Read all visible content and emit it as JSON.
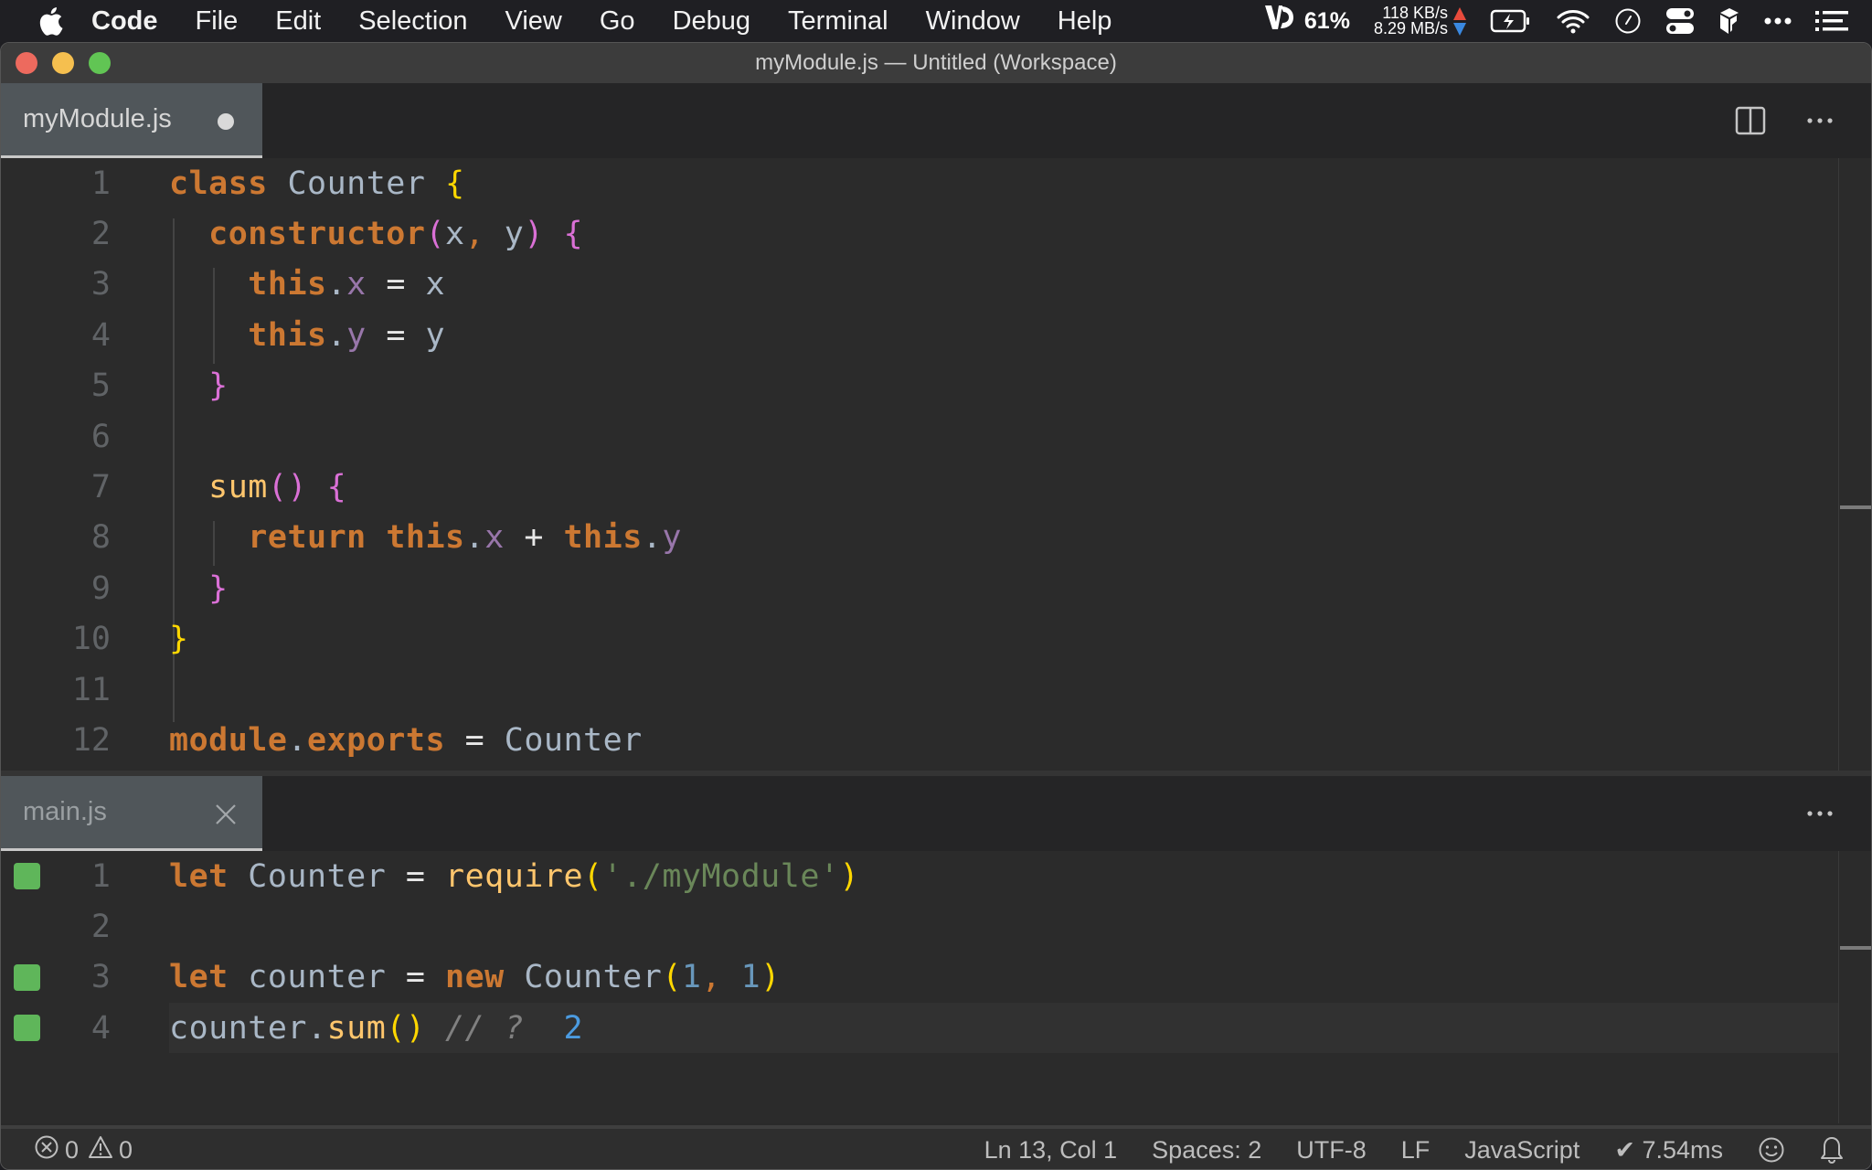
{
  "menubar": {
    "app_name": "Code",
    "items": [
      "File",
      "Edit",
      "Selection",
      "View",
      "Go",
      "Debug",
      "Terminal",
      "Window",
      "Help"
    ],
    "tray": {
      "battery_app_percent": "61%",
      "upload_speed": "118 KB/s",
      "download_speed": "8.29 MB/s",
      "icons": [
        "battery-charging-icon",
        "wifi-icon",
        "clock-icon",
        "control-center-icon",
        "app-tray-icon",
        "more-icon",
        "list-icon"
      ]
    }
  },
  "window": {
    "title": "myModule.js — Untitled (Workspace)"
  },
  "top_pane": {
    "tab": {
      "label": "myModule.js",
      "dirty": true
    },
    "actions": [
      "split-editor",
      "more-actions"
    ],
    "lines": [
      {
        "n": "1",
        "tokens": [
          [
            "kw",
            "class"
          ],
          [
            "ident",
            " "
          ],
          [
            "cls",
            "Counter"
          ],
          [
            "ident",
            " "
          ],
          [
            "brace1",
            "{"
          ]
        ]
      },
      {
        "n": "2",
        "tokens": [
          [
            "ident",
            "  "
          ],
          [
            "kw",
            "constructor"
          ],
          [
            "brace2",
            "("
          ],
          [
            "ident",
            "x"
          ],
          [
            "comma",
            ","
          ],
          [
            "ident",
            " y"
          ],
          [
            "brace2",
            ")"
          ],
          [
            "ident",
            " "
          ],
          [
            "brace2",
            "{"
          ]
        ]
      },
      {
        "n": "3",
        "tokens": [
          [
            "ident",
            "    "
          ],
          [
            "kw",
            "this"
          ],
          [
            "punc",
            "."
          ],
          [
            "prop",
            "x"
          ],
          [
            "op",
            " = "
          ],
          [
            "ident",
            "x"
          ]
        ]
      },
      {
        "n": "4",
        "tokens": [
          [
            "ident",
            "    "
          ],
          [
            "kw",
            "this"
          ],
          [
            "punc",
            "."
          ],
          [
            "prop",
            "y"
          ],
          [
            "op",
            " = "
          ],
          [
            "ident",
            "y"
          ]
        ]
      },
      {
        "n": "5",
        "tokens": [
          [
            "ident",
            "  "
          ],
          [
            "brace2",
            "}"
          ]
        ]
      },
      {
        "n": "6",
        "tokens": []
      },
      {
        "n": "7",
        "tokens": [
          [
            "ident",
            "  "
          ],
          [
            "fn",
            "sum"
          ],
          [
            "brace2",
            "()"
          ],
          [
            "ident",
            " "
          ],
          [
            "brace2",
            "{"
          ]
        ]
      },
      {
        "n": "8",
        "tokens": [
          [
            "ident",
            "    "
          ],
          [
            "kw",
            "return"
          ],
          [
            "ident",
            " "
          ],
          [
            "kw",
            "this"
          ],
          [
            "punc",
            "."
          ],
          [
            "prop",
            "x"
          ],
          [
            "op",
            " + "
          ],
          [
            "kw",
            "this"
          ],
          [
            "punc",
            "."
          ],
          [
            "prop",
            "y"
          ]
        ]
      },
      {
        "n": "9",
        "tokens": [
          [
            "ident",
            "  "
          ],
          [
            "brace2",
            "}"
          ]
        ]
      },
      {
        "n": "10",
        "tokens": [
          [
            "brace1",
            "}"
          ]
        ]
      },
      {
        "n": "11",
        "tokens": []
      },
      {
        "n": "12",
        "tokens": [
          [
            "kw",
            "module"
          ],
          [
            "punc",
            "."
          ],
          [
            "kw",
            "exports"
          ],
          [
            "op",
            " = "
          ],
          [
            "cls",
            "Counter"
          ]
        ]
      }
    ]
  },
  "bottom_pane": {
    "tab": {
      "label": "main.js"
    },
    "actions": [
      "more-actions"
    ],
    "lines": [
      {
        "n": "1",
        "covered": true,
        "tokens": [
          [
            "kw",
            "let"
          ],
          [
            "ident",
            " Counter"
          ],
          [
            "op",
            " = "
          ],
          [
            "fn",
            "require"
          ],
          [
            "brace1",
            "("
          ],
          [
            "str",
            "'./myModule'"
          ],
          [
            "brace1",
            ")"
          ]
        ]
      },
      {
        "n": "2",
        "covered": false,
        "tokens": []
      },
      {
        "n": "3",
        "covered": true,
        "tokens": [
          [
            "kw",
            "let"
          ],
          [
            "ident",
            " counter"
          ],
          [
            "op",
            " = "
          ],
          [
            "kw",
            "new"
          ],
          [
            "ident",
            " "
          ],
          [
            "cls",
            "Counter"
          ],
          [
            "brace1",
            "("
          ],
          [
            "num",
            "1"
          ],
          [
            "comma",
            ","
          ],
          [
            "ident",
            " "
          ],
          [
            "num",
            "1"
          ],
          [
            "brace1",
            ")"
          ]
        ]
      },
      {
        "n": "4",
        "covered": true,
        "current": true,
        "tokens": [
          [
            "ident",
            "counter"
          ],
          [
            "punc",
            "."
          ],
          [
            "fn",
            "sum"
          ],
          [
            "brace1",
            "()"
          ],
          [
            "ident",
            " "
          ],
          [
            "cmt",
            "// ?"
          ],
          [
            "ident",
            "  "
          ],
          [
            "result",
            "2"
          ]
        ]
      }
    ]
  },
  "statusbar": {
    "errors": "0",
    "warnings": "0",
    "cursor": "Ln 13, Col 1",
    "indent": "Spaces: 2",
    "encoding": "UTF-8",
    "eol": "LF",
    "language": "JavaScript",
    "timing": "✔ 7.54ms"
  },
  "colors": {
    "coverage_green": "#5fb65a",
    "keyword": "#cc7832",
    "function": "#ffc66d",
    "string": "#6a8759",
    "number": "#6897bb",
    "property": "#9876aa",
    "bracket_level1": "#ffd700",
    "bracket_level2": "#da70d6",
    "result_value": "#4b9be0"
  }
}
